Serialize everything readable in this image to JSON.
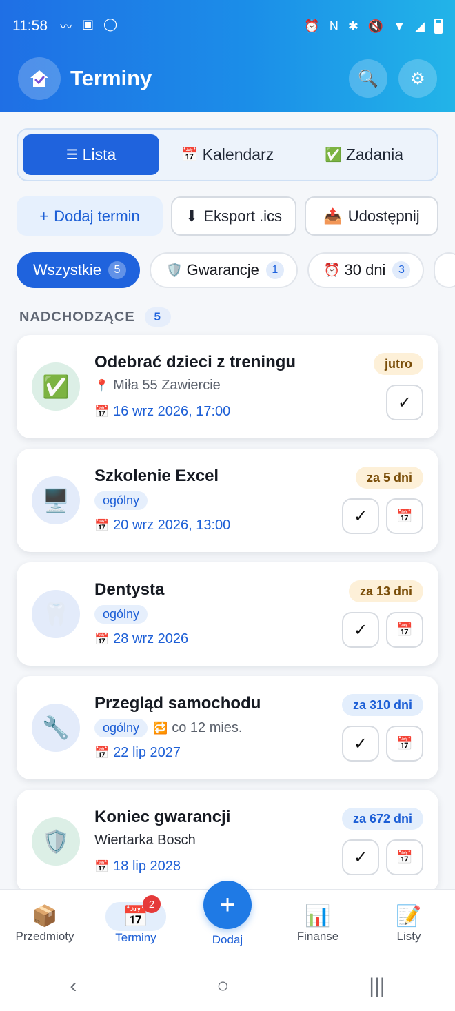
{
  "status": {
    "time": "11:58",
    "left_icons": [
      "hand-icon",
      "message-icon",
      "whatsapp-icon"
    ],
    "right_icons": [
      "alarm-icon",
      "nfc-icon",
      "bluetooth-icon",
      "mute-icon",
      "wifi-icon",
      "signal-icon",
      "battery-icon"
    ]
  },
  "appbar": {
    "title": "Terminy"
  },
  "tabs": [
    {
      "icon": "☰",
      "label": "Lista"
    },
    {
      "icon": "📅",
      "label": "Kalendarz"
    },
    {
      "icon": "✅",
      "label": "Zadania"
    }
  ],
  "actions": {
    "add": {
      "icon": "+",
      "label": "Dodaj termin"
    },
    "export": {
      "icon": "⬇",
      "label": "Eksport .ics"
    },
    "share": {
      "icon": "📤",
      "label": "Udostępnij"
    }
  },
  "filters": [
    {
      "icon": "",
      "label": "Wszystkie",
      "count": "5"
    },
    {
      "icon": "🛡️",
      "label": "Gwarancje",
      "count": "1"
    },
    {
      "icon": "⏰",
      "label": "30 dni",
      "count": "3"
    }
  ],
  "section": {
    "title": "NADCHODZĄCE",
    "count": "5"
  },
  "cards": [
    {
      "title": "Odebrać dzieci z treningu",
      "icon": "✅",
      "avatar_color": "#dcefe6",
      "tag": "",
      "location_icon": "📍",
      "line2": "Miła 55 Zawiercie",
      "date": "16 wrz 2026, 17:00",
      "badge": "jutro",
      "badge_kind": "warn",
      "has_calendar": false
    },
    {
      "title": "Szkolenie Excel",
      "icon": "🖥️",
      "avatar_color": "#e3ebfa",
      "tag": "ogólny",
      "line2": "",
      "date": "20 wrz 2026, 13:00",
      "badge": "za 5 dni",
      "badge_kind": "warn",
      "has_calendar": true
    },
    {
      "title": "Dentysta",
      "icon": "🦷",
      "avatar_color": "#e3ebfa",
      "tag": "ogólny",
      "line2": "",
      "date": "28 wrz 2026",
      "badge": "za 13 dni",
      "badge_kind": "warn",
      "has_calendar": true
    },
    {
      "title": "Przegląd samochodu",
      "icon": "🔧",
      "avatar_color": "#e3ebfa",
      "tag": "ogólny",
      "repeat_icon": "🔁",
      "line2": "co 12 mies.",
      "date": "22 lip 2027",
      "badge": "za 310 dni",
      "badge_kind": "info",
      "has_calendar": true
    },
    {
      "title": "Koniec gwarancji",
      "icon": "🛡️",
      "avatar_color": "#dcefe6",
      "tag": "",
      "line2": "Wiertarka Bosch",
      "date": "18 lip 2028",
      "badge": "za 672 dni",
      "badge_kind": "info",
      "has_calendar": true
    }
  ],
  "bottom_nav": {
    "items": [
      {
        "icon": "📦",
        "label": "Przedmioty"
      },
      {
        "icon": "📅",
        "label": "Terminy",
        "badge": "2"
      },
      {
        "icon": "📊",
        "label": "Finanse"
      },
      {
        "icon": "📝",
        "label": "Listy"
      }
    ],
    "fab": {
      "icon": "+",
      "label": "Dodaj"
    }
  },
  "colors": {
    "primary": "#1f63dd",
    "header_start": "#1f6fe5",
    "header_end": "#22b4e8"
  }
}
